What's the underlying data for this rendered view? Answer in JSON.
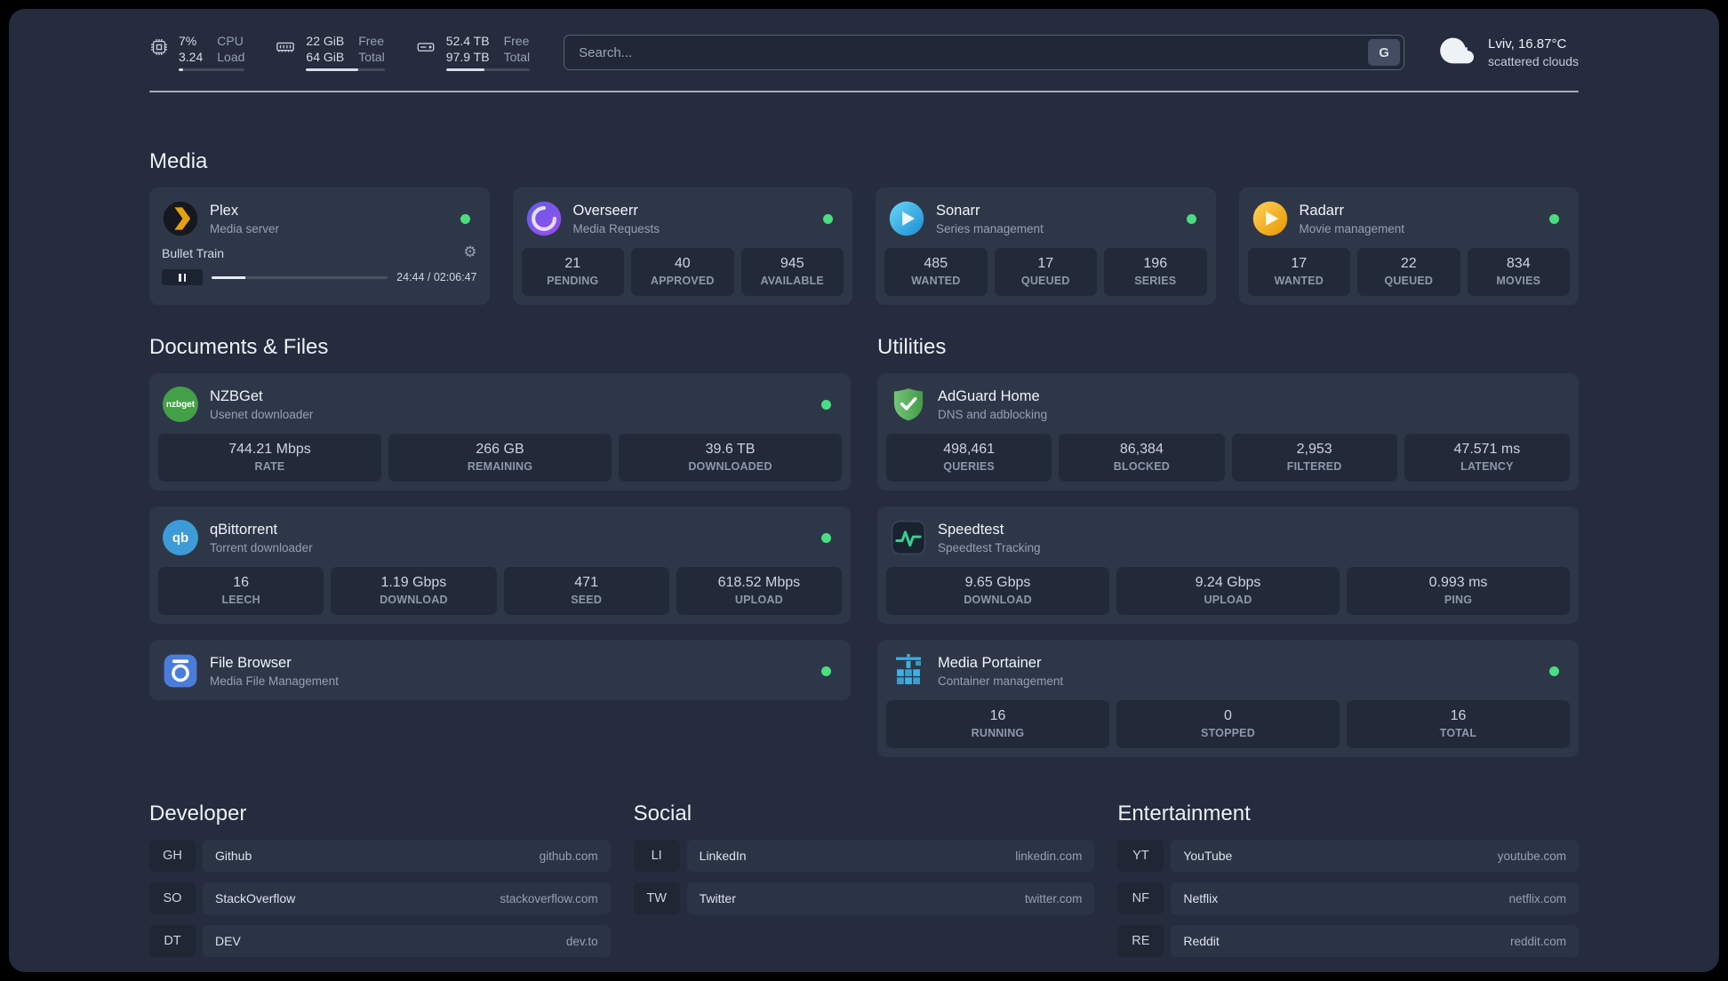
{
  "colors": {
    "status_online": "#4ade80",
    "background": "#242c3d",
    "card": "#2e3748",
    "stat_tile": "#222a3a",
    "plex_amber": "#e5a00d",
    "overseerr_purple": "#7b5cf0",
    "sonarr_blue": "#35c5f4",
    "radarr_amber": "#ffc230",
    "nzbget_green": "#44a047",
    "qbittorrent_blue": "#3d9cd8",
    "filebrowser_blue": "#4a7ddb",
    "adguard_green": "#67c16b",
    "speedtest_green": "#35d08e",
    "portainer_blue": "#3eb0e5"
  },
  "icons": {
    "gear": "⚙"
  },
  "topbar": {
    "resources": [
      {
        "name": "cpu",
        "value": "7%",
        "sub": "3.24",
        "label_top": "CPU",
        "label_bottom": "Load",
        "progress": 7
      },
      {
        "name": "memory",
        "value": "22 GiB",
        "sub": "64 GiB",
        "label_top": "Free",
        "label_bottom": "Total",
        "progress": 66
      },
      {
        "name": "disk",
        "value": "52.4 TB",
        "sub": "97.9 TB",
        "label_top": "Free",
        "label_bottom": "Total",
        "progress": 46
      }
    ],
    "search": {
      "placeholder": "Search...",
      "provider_button": "G"
    },
    "weather": {
      "location": "Lviv, 16.87°C",
      "condition": "scattered clouds"
    }
  },
  "sections": {
    "media": {
      "title": "Media",
      "plex": {
        "name": "Plex",
        "description": "Media server",
        "player": {
          "title": "Bullet Train",
          "time": "24:44 / 02:06:47",
          "progress": 19
        }
      },
      "overseerr": {
        "name": "Overseerr",
        "description": "Media Requests",
        "stats": [
          {
            "value": "21",
            "label": "PENDING"
          },
          {
            "value": "40",
            "label": "APPROVED"
          },
          {
            "value": "945",
            "label": "AVAILABLE"
          }
        ]
      },
      "sonarr": {
        "name": "Sonarr",
        "description": "Series management",
        "stats": [
          {
            "value": "485",
            "label": "WANTED"
          },
          {
            "value": "17",
            "label": "QUEUED"
          },
          {
            "value": "196",
            "label": "SERIES"
          }
        ]
      },
      "radarr": {
        "name": "Radarr",
        "description": "Movie management",
        "stats": [
          {
            "value": "17",
            "label": "WANTED"
          },
          {
            "value": "22",
            "label": "QUEUED"
          },
          {
            "value": "834",
            "label": "MOVIES"
          }
        ]
      }
    },
    "documents": {
      "title": "Documents & Files",
      "nzbget": {
        "name": "NZBGet",
        "description": "Usenet downloader",
        "icon_text": "nzbget",
        "stats": [
          {
            "value": "744.21 Mbps",
            "label": "RATE"
          },
          {
            "value": "266 GB",
            "label": "REMAINING"
          },
          {
            "value": "39.6 TB",
            "label": "DOWNLOADED"
          }
        ]
      },
      "qbittorrent": {
        "name": "qBittorrent",
        "description": "Torrent downloader",
        "icon_text": "qb",
        "stats": [
          {
            "value": "16",
            "label": "LEECH"
          },
          {
            "value": "1.19 Gbps",
            "label": "DOWNLOAD"
          },
          {
            "value": "471",
            "label": "SEED"
          },
          {
            "value": "618.52 Mbps",
            "label": "UPLOAD"
          }
        ]
      },
      "filebrowser": {
        "name": "File Browser",
        "description": "Media File Management"
      }
    },
    "utilities": {
      "title": "Utilities",
      "adguard": {
        "name": "AdGuard Home",
        "description": "DNS and adblocking",
        "stats": [
          {
            "value": "498,461",
            "label": "QUERIES"
          },
          {
            "value": "86,384",
            "label": "BLOCKED"
          },
          {
            "value": "2,953",
            "label": "FILTERED"
          },
          {
            "value": "47.571 ms",
            "label": "LATENCY"
          }
        ]
      },
      "speedtest": {
        "name": "Speedtest",
        "description": "Speedtest Tracking",
        "stats": [
          {
            "value": "9.65 Gbps",
            "label": "DOWNLOAD"
          },
          {
            "value": "9.24 Gbps",
            "label": "UPLOAD"
          },
          {
            "value": "0.993 ms",
            "label": "PING"
          }
        ]
      },
      "portainer": {
        "name": "Media Portainer",
        "description": "Container management",
        "stats": [
          {
            "value": "16",
            "label": "RUNNING"
          },
          {
            "value": "0",
            "label": "STOPPED"
          },
          {
            "value": "16",
            "label": "TOTAL"
          }
        ]
      }
    },
    "bookmarks": {
      "developer": {
        "title": "Developer",
        "items": [
          {
            "abbr": "GH",
            "name": "Github",
            "domain": "github.com"
          },
          {
            "abbr": "SO",
            "name": "StackOverflow",
            "domain": "stackoverflow.com"
          },
          {
            "abbr": "DT",
            "name": "DEV",
            "domain": "dev.to"
          }
        ]
      },
      "social": {
        "title": "Social",
        "items": [
          {
            "abbr": "LI",
            "name": "LinkedIn",
            "domain": "linkedin.com"
          },
          {
            "abbr": "TW",
            "name": "Twitter",
            "domain": "twitter.com"
          }
        ]
      },
      "entertainment": {
        "title": "Entertainment",
        "items": [
          {
            "abbr": "YT",
            "name": "YouTube",
            "domain": "youtube.com"
          },
          {
            "abbr": "NF",
            "name": "Netflix",
            "domain": "netflix.com"
          },
          {
            "abbr": "RE",
            "name": "Reddit",
            "domain": "reddit.com"
          }
        ]
      }
    }
  }
}
